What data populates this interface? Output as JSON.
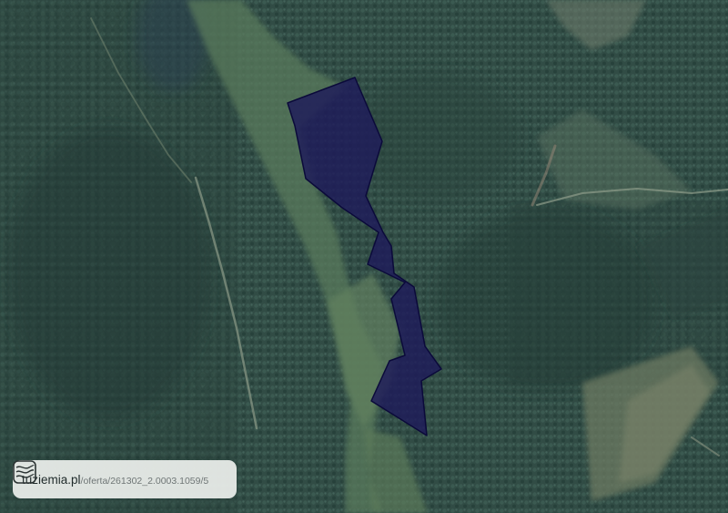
{
  "map": {
    "type": "satellite-imagery",
    "colors": {
      "forest_dark": "#2c4540",
      "forest_mid": "#3a5a4f",
      "meadow": "#5f7d5c",
      "clearing": "#6b7a62",
      "parcel_fill": "#1e1b5a",
      "parcel_stroke": "#0b0a3a"
    },
    "parcel": {
      "name": "parcel-outline"
    }
  },
  "attribution": {
    "logo_icon": "contour-map-icon",
    "brand": "tuziemia.pl",
    "path": "/oferta/261302_2.0003.1059/5"
  }
}
